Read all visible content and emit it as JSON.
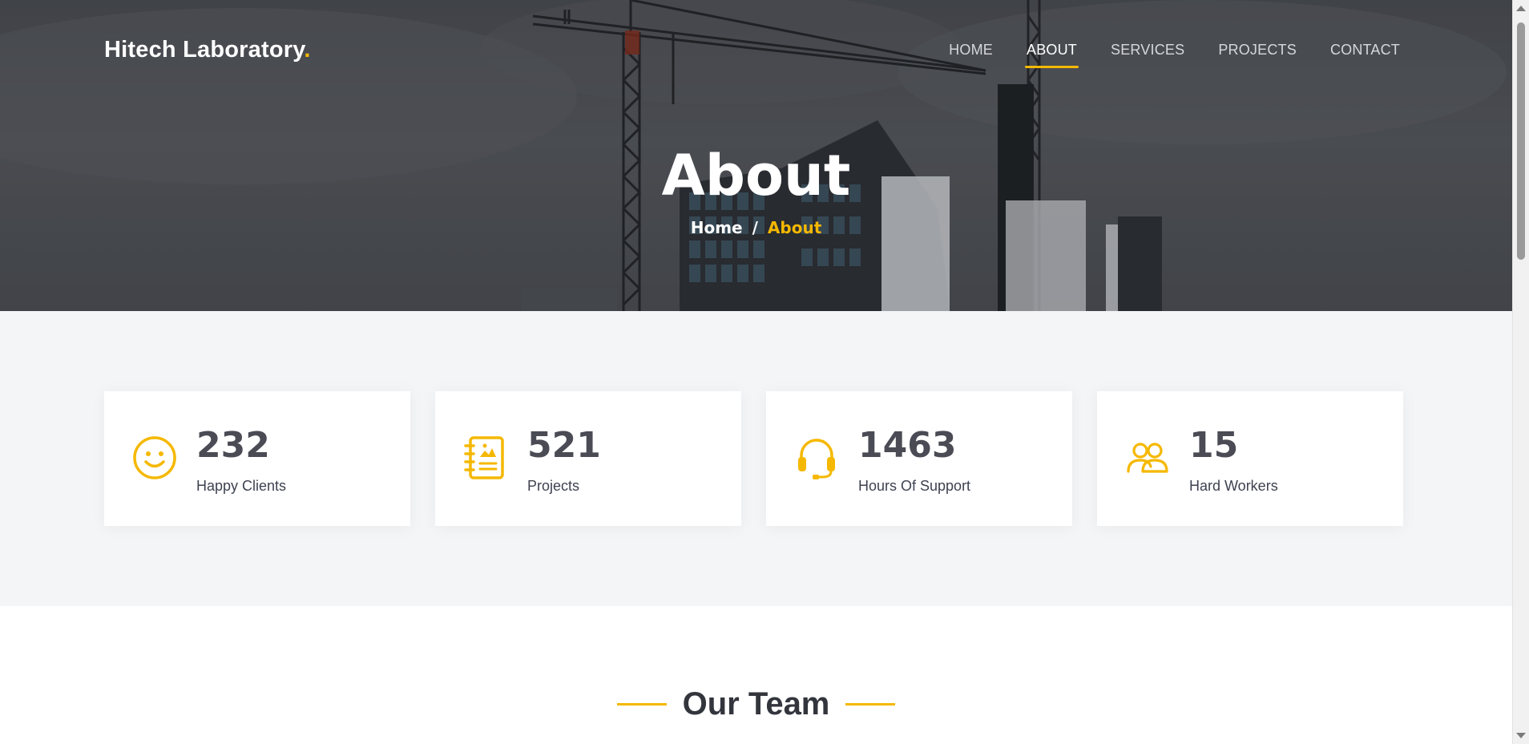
{
  "header": {
    "logo_text": "Hitech Laboratory",
    "logo_dot": ".",
    "nav": [
      {
        "label": "HOME",
        "active": false
      },
      {
        "label": "ABOUT",
        "active": true
      },
      {
        "label": "SERVICES",
        "active": false
      },
      {
        "label": "PROJECTS",
        "active": false
      },
      {
        "label": "CONTACT",
        "active": false
      }
    ]
  },
  "hero": {
    "title": "About",
    "breadcrumb": {
      "home": "Home",
      "separator": "/",
      "current": "About"
    }
  },
  "stats": [
    {
      "value": "232",
      "label": "Happy Clients",
      "icon": "smiley-icon"
    },
    {
      "value": "521",
      "label": "Projects",
      "icon": "journal-icon"
    },
    {
      "value": "1463",
      "label": "Hours Of Support",
      "icon": "headset-icon"
    },
    {
      "value": "15",
      "label": "Hard Workers",
      "icon": "people-icon"
    }
  ],
  "team": {
    "title": "Our Team"
  },
  "colors": {
    "accent": "#f5b800",
    "dark_text": "#4a4b54",
    "stats_bg": "#f4f5f7"
  }
}
